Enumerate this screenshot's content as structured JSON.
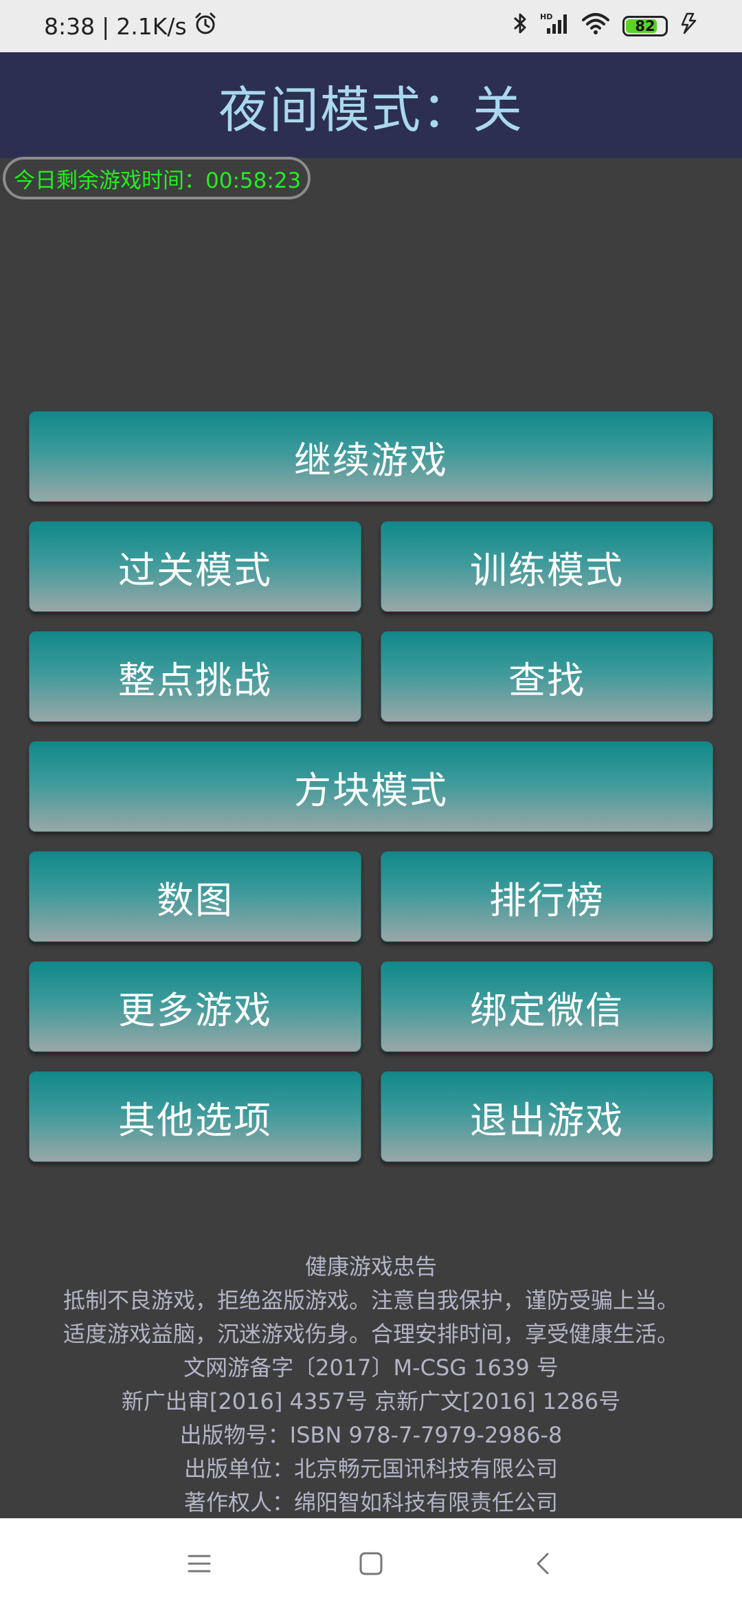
{
  "status_bar": {
    "time": "8:38",
    "separator": "|",
    "net_speed": "2.1K/s",
    "battery": "82",
    "icons": [
      "alarm-icon",
      "bluetooth-icon",
      "hd-signal-icon",
      "wifi-icon",
      "battery-icon",
      "charging-icon"
    ],
    "battery_level": 0.82
  },
  "header": {
    "title": "夜间模式：关"
  },
  "timer": {
    "label": "今日剩余游戏时间：00:58:23"
  },
  "buttons": {
    "continue": "继续游戏",
    "level_mode": "过关模式",
    "training_mode": "训练模式",
    "hourly_challenge": "整点挑战",
    "search": "查找",
    "block_mode": "方块模式",
    "count_map": "数图",
    "leaderboard": "排行榜",
    "more_games": "更多游戏",
    "bind_wechat": "绑定微信",
    "other_options": "其他选项",
    "exit_game": "退出游戏"
  },
  "notice": {
    "title": "健康游戏忠告",
    "line1": "抵制不良游戏，拒绝盗版游戏。注意自我保护，谨防受骗上当。",
    "line2": "适度游戏益脑，沉迷游戏伤身。合理安排时间，享受健康生活。",
    "line3": "文网游备字〔2017〕M-CSG 1639 号",
    "line4": "新广出审[2016] 4357号 京新广文[2016] 1286号",
    "line5": "出版物号：ISBN 978-7-7979-2986-8",
    "line6": "出版单位：北京畅元国讯科技有限公司",
    "line7": "著作权人：绵阳智如科技有限责任公司"
  },
  "nav": {
    "icons": [
      "menu-icon",
      "home-icon",
      "back-icon"
    ]
  },
  "colors": {
    "header_bg": "#2d2f50",
    "header_text": "#a9d8f0",
    "timer_text": "#22ee22",
    "button_top": "#11888a",
    "button_bottom": "#9aa7a7",
    "page_bg": "#3e3e3e"
  }
}
